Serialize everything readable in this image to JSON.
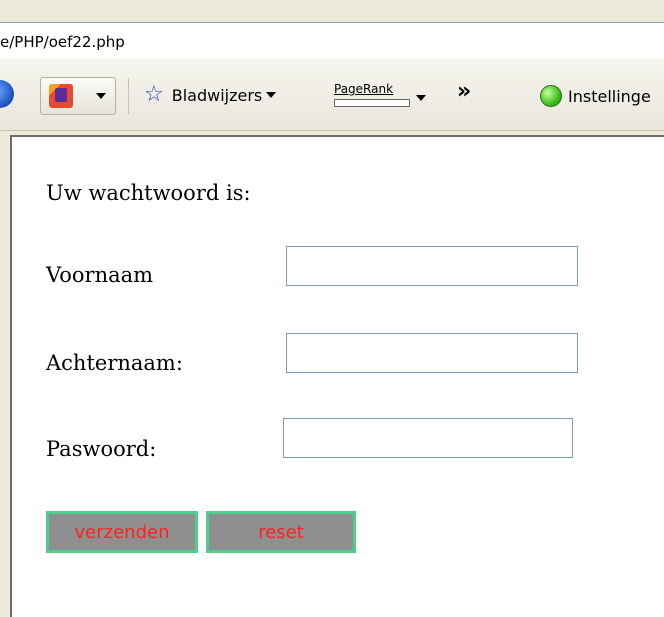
{
  "browser": {
    "address": "e/PHP/oef22.php",
    "toolbar": {
      "bookmarks_label": "Bladwijzers",
      "pagerank_label": "PageRank",
      "more_label": "»",
      "settings_label": "Instellinge"
    }
  },
  "page": {
    "password_text": "Uw wachtwoord is:",
    "fields": [
      {
        "label": "Voornaam",
        "value": ""
      },
      {
        "label": "Achternaam:",
        "value": ""
      },
      {
        "label": "Paswoord:",
        "value": ""
      }
    ],
    "buttons": {
      "submit_label": "verzenden",
      "reset_label": "reset"
    }
  },
  "colors": {
    "button_bg": "#8f8f8f",
    "button_border": "#4fd08a",
    "button_text": "#ff2020",
    "input_border": "#7f9db9"
  }
}
